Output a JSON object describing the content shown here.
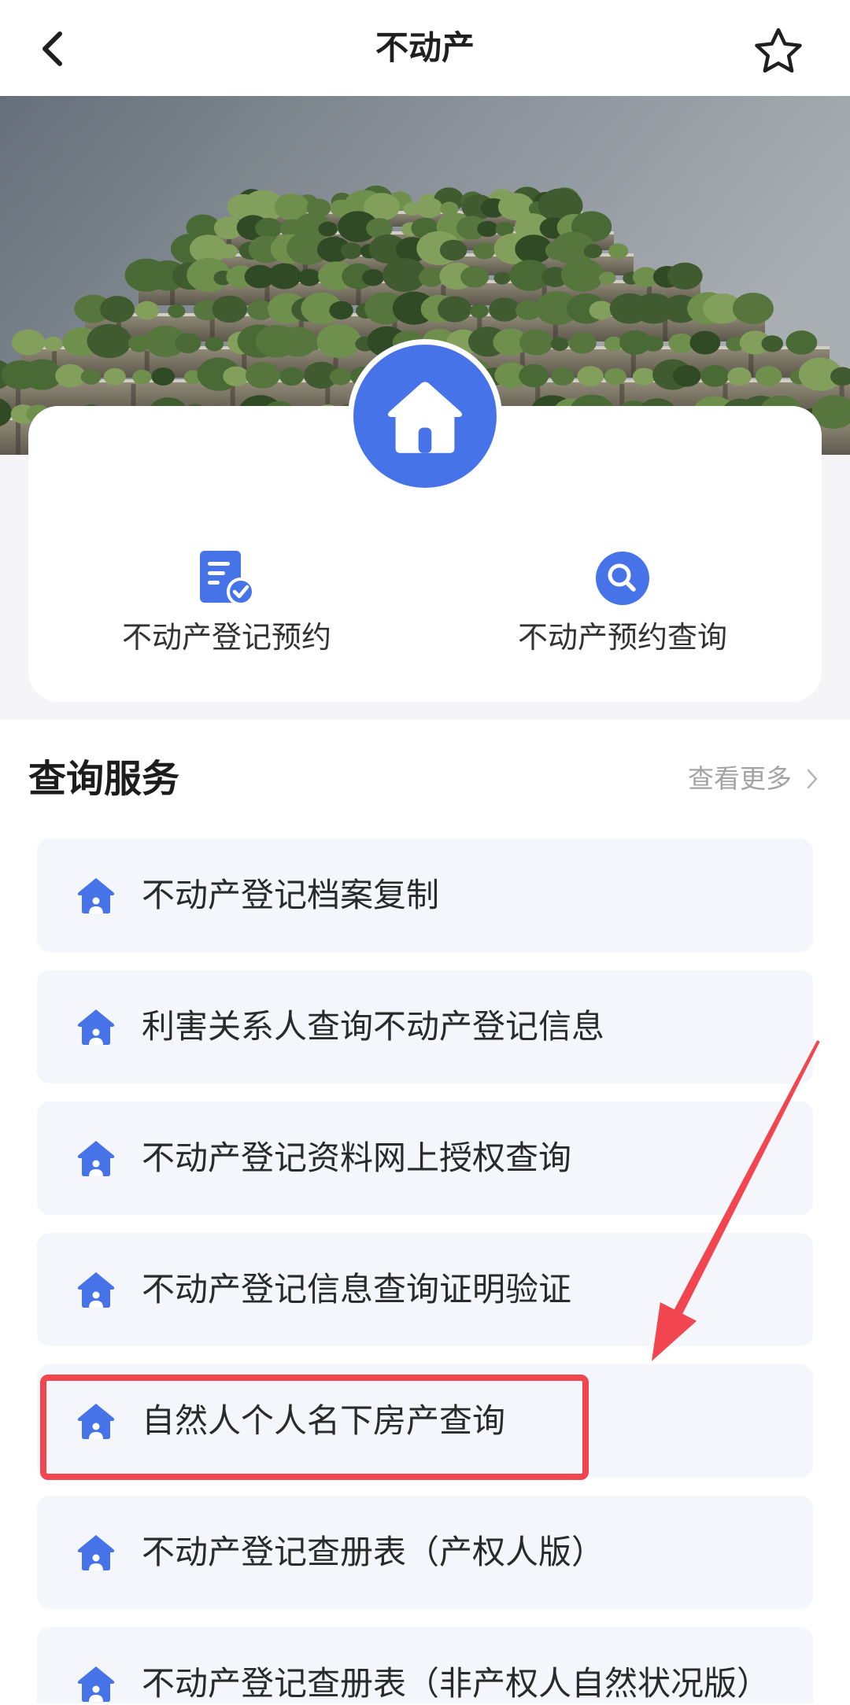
{
  "header": {
    "title": "不动产",
    "back_icon": "chevron-left-icon",
    "favorite_icon": "star-outline-icon"
  },
  "hero": {
    "badge_icon": "house-icon"
  },
  "quick_actions": [
    {
      "label": "不动产登记预约",
      "icon": "document-check-icon"
    },
    {
      "label": "不动产预约查询",
      "icon": "search-icon"
    }
  ],
  "query_services": {
    "title": "查询服务",
    "more_label": "查看更多",
    "more_icon": "chevron-right-icon",
    "item_icon": "house-icon",
    "items": [
      {
        "label": "不动产登记档案复制"
      },
      {
        "label": "利害关系人查询不动产登记信息"
      },
      {
        "label": "不动产登记资料网上授权查询"
      },
      {
        "label": "不动产登记信息查询证明验证"
      },
      {
        "label": "自然人个人名下房产查询"
      },
      {
        "label": "不动产登记查册表（产权人版）"
      },
      {
        "label": "不动产登记查册表（非产权人自然状况版）"
      }
    ]
  },
  "colors": {
    "accent": "#4773e8",
    "list_background": "#f4f6fb",
    "page_background": "#f5f5f7",
    "highlight": "#f1464f",
    "text": "#262626",
    "muted": "#a3a3a3"
  }
}
